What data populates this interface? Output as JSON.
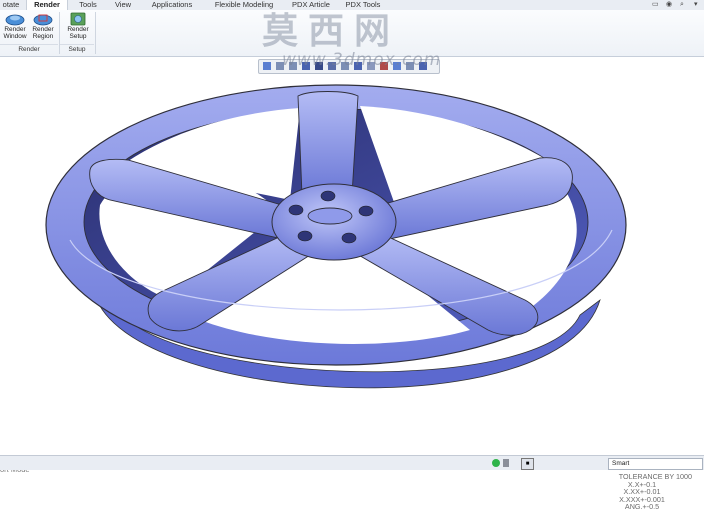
{
  "tabs": [
    {
      "label": "otate"
    },
    {
      "label": "Render",
      "active": true
    },
    {
      "label": "Tools"
    },
    {
      "label": "View"
    },
    {
      "label": "Applications"
    },
    {
      "label": "Flexible Modeling"
    },
    {
      "label": "PDX Article"
    },
    {
      "label": "PDX Tools"
    }
  ],
  "ribbon": {
    "buttons": [
      {
        "label_1": "Render",
        "label_2": "Window",
        "icon": "render-window-icon"
      },
      {
        "label_1": "Render",
        "label_2": "Region",
        "icon": "render-region-icon"
      },
      {
        "label_1": "Render",
        "label_2": "Setup",
        "icon": "render-setup-icon"
      }
    ],
    "groups": [
      {
        "label": "Render"
      },
      {
        "label": "Setup"
      }
    ]
  },
  "watermark": {
    "cn": "莫西网",
    "en": "www.3dmox.com"
  },
  "viewport": {
    "mode_text": "ort Mode",
    "tolerance": {
      "title": "TOLERANCE BY 1000",
      "lines": [
        "X.X+-0.1",
        "X.XX+-0.01",
        "X.XXX+-0.001",
        "ANG.+-0.5"
      ]
    },
    "model_color": "#7a86e0"
  },
  "status": {
    "filter_value": "Smart"
  }
}
